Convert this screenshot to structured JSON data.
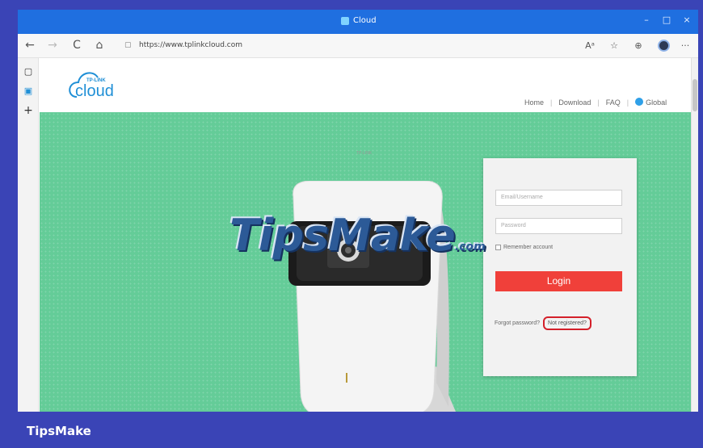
{
  "window": {
    "title": "Cloud",
    "controls": {
      "minimize": "–",
      "maximize": "□",
      "close": "×"
    }
  },
  "toolbar": {
    "back": "←",
    "forward": "→",
    "reload": "C",
    "home": "⌂",
    "lock": "🔒",
    "url": "https://www.tplinkcloud.com",
    "read_aloud": "Aᵃ",
    "favorite": "☆",
    "collections": "⊕",
    "more": "···"
  },
  "sidebar": {
    "tab1": "▢",
    "tab2": "▣",
    "add": "+"
  },
  "site": {
    "brand": "TP-LINK",
    "logo_word": "cloud",
    "nav": [
      "Home",
      "Download",
      "FAQ",
      "Global"
    ]
  },
  "camera": {
    "label": "TP-LINK"
  },
  "login": {
    "email_placeholder": "Email/Username",
    "password_placeholder": "Password",
    "remember_label": "Remember account",
    "login_label": "Login",
    "forgot_label": "Forgot password?",
    "register_label": "Not registered?"
  },
  "watermark": {
    "text": "TipsMake",
    "suffix": ".com"
  },
  "caption": "TipsMake",
  "colors": {
    "frame": "#3a44b6",
    "titlebar": "#1f6fe0",
    "hero": "#64cc98",
    "login_button": "#f0403a",
    "highlight": "#d4202a"
  }
}
